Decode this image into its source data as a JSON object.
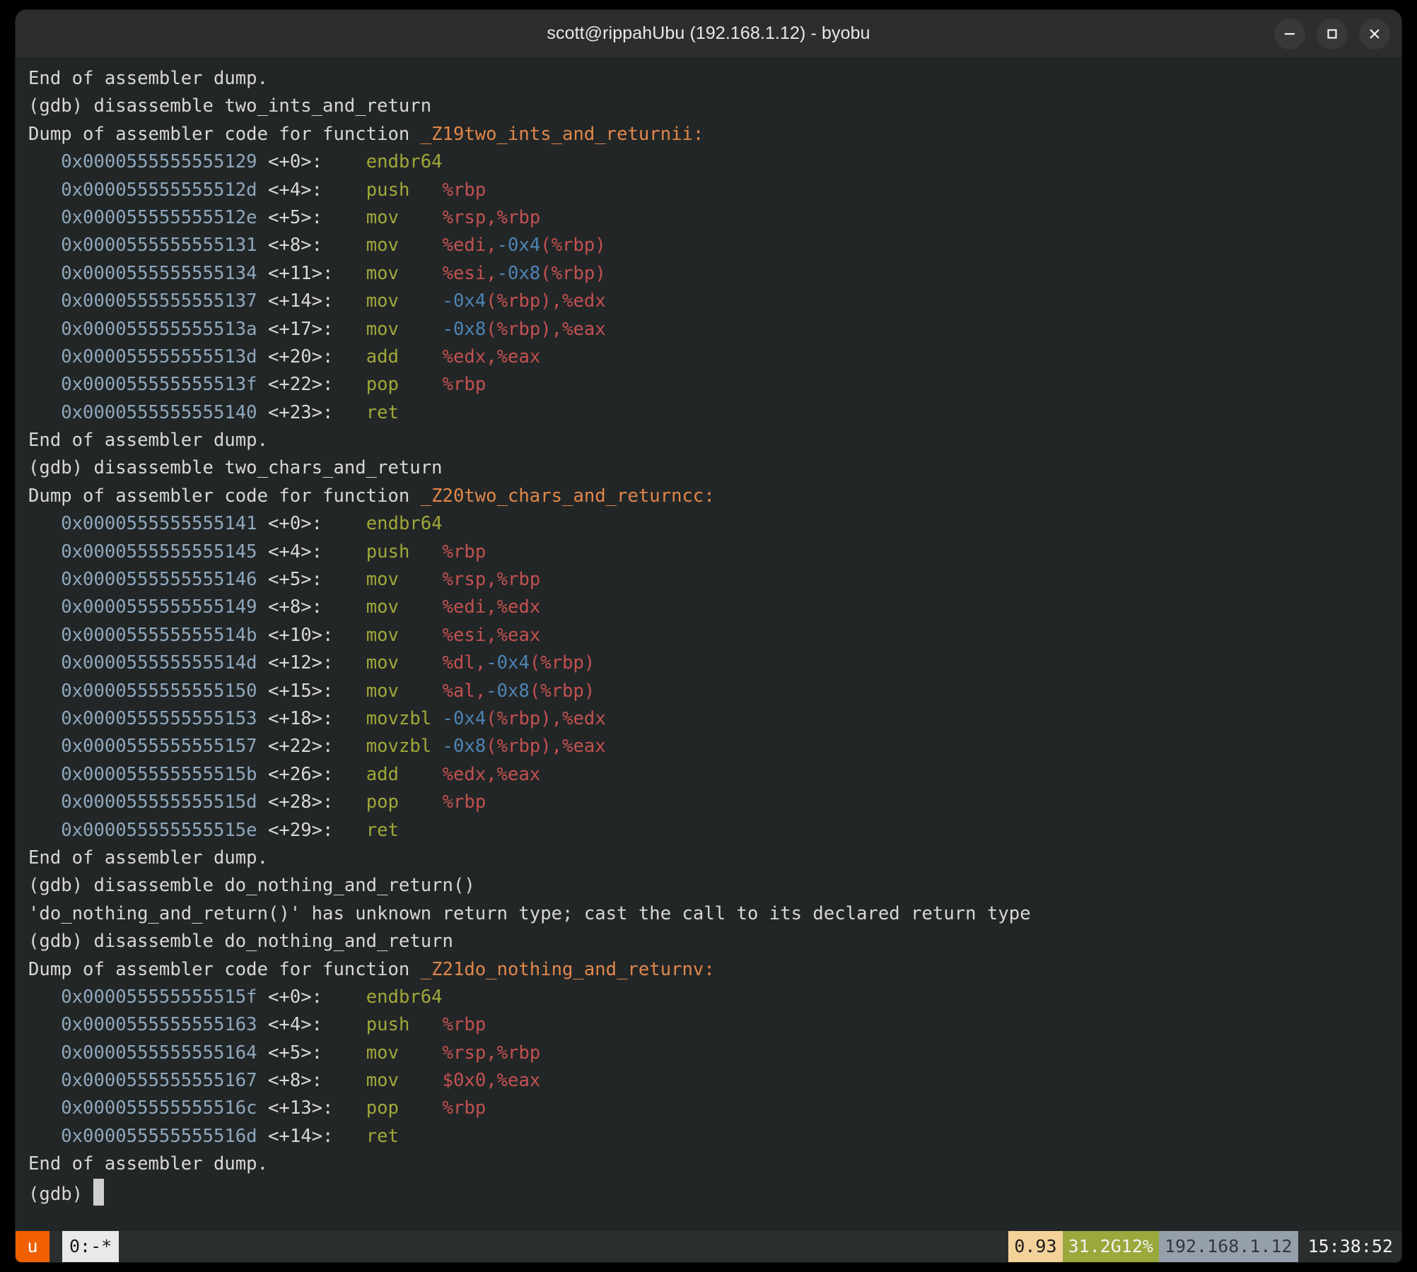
{
  "window": {
    "title": "scott@rippahUbu (192.168.1.12) - byobu",
    "controls": [
      {
        "name": "minimize-button",
        "label": "–"
      },
      {
        "name": "maximize-button",
        "label": "□"
      },
      {
        "name": "close-button",
        "label": "✕"
      }
    ]
  },
  "colors": {
    "background": "#232627",
    "foreground": "#d8d8d4",
    "address": "#8fa8bd",
    "mnemonic": "#a0a838",
    "register": "#c25151",
    "hex_offset": "#4d84b4",
    "symbol": "#e0874a",
    "titlebar": "#2d2d2d",
    "status_u_bg": "#f06000",
    "status_window_bg": "#e9e9e9",
    "status_load_bg": "#f3d29a",
    "status_mem_bg": "#9aa83c",
    "status_ip_bg": "#96a0ad"
  },
  "terminal": {
    "prompt": "(gdb) ",
    "lines": [
      {
        "kind": "plain",
        "text": "End of assembler dump."
      },
      {
        "kind": "prompt",
        "command": "disassemble two_ints_and_return"
      },
      {
        "kind": "header",
        "prefix": "Dump of assembler code for function ",
        "symbol": "_Z19two_ints_and_returnii:"
      },
      {
        "kind": "insn",
        "addr": "0x0000555555555129",
        "off": "<+0>:",
        "mnem": "endbr64",
        "ops": []
      },
      {
        "kind": "insn",
        "addr": "0x000055555555512d",
        "off": "<+4>:",
        "mnem": "push",
        "ops": [
          {
            "t": "reg",
            "v": "%rbp"
          }
        ]
      },
      {
        "kind": "insn",
        "addr": "0x000055555555512e",
        "off": "<+5>:",
        "mnem": "mov",
        "ops": [
          {
            "t": "reg",
            "v": "%rsp,%rbp"
          }
        ]
      },
      {
        "kind": "insn",
        "addr": "0x0000555555555131",
        "off": "<+8>:",
        "mnem": "mov",
        "ops": [
          {
            "t": "reg",
            "v": "%edi,"
          },
          {
            "t": "hex",
            "v": "-0x4"
          },
          {
            "t": "reg",
            "v": "(%rbp)"
          }
        ]
      },
      {
        "kind": "insn",
        "addr": "0x0000555555555134",
        "off": "<+11>:",
        "mnem": "mov",
        "ops": [
          {
            "t": "reg",
            "v": "%esi,"
          },
          {
            "t": "hex",
            "v": "-0x8"
          },
          {
            "t": "reg",
            "v": "(%rbp)"
          }
        ]
      },
      {
        "kind": "insn",
        "addr": "0x0000555555555137",
        "off": "<+14>:",
        "mnem": "mov",
        "ops": [
          {
            "t": "hex",
            "v": "-0x4"
          },
          {
            "t": "reg",
            "v": "(%rbp),%edx"
          }
        ]
      },
      {
        "kind": "insn",
        "addr": "0x000055555555513a",
        "off": "<+17>:",
        "mnem": "mov",
        "ops": [
          {
            "t": "hex",
            "v": "-0x8"
          },
          {
            "t": "reg",
            "v": "(%rbp),%eax"
          }
        ]
      },
      {
        "kind": "insn",
        "addr": "0x000055555555513d",
        "off": "<+20>:",
        "mnem": "add",
        "ops": [
          {
            "t": "reg",
            "v": "%edx,%eax"
          }
        ]
      },
      {
        "kind": "insn",
        "addr": "0x000055555555513f",
        "off": "<+22>:",
        "mnem": "pop",
        "ops": [
          {
            "t": "reg",
            "v": "%rbp"
          }
        ]
      },
      {
        "kind": "insn",
        "addr": "0x0000555555555140",
        "off": "<+23>:",
        "mnem": "ret",
        "ops": []
      },
      {
        "kind": "plain",
        "text": "End of assembler dump."
      },
      {
        "kind": "prompt",
        "command": "disassemble two_chars_and_return"
      },
      {
        "kind": "header",
        "prefix": "Dump of assembler code for function ",
        "symbol": "_Z20two_chars_and_returncc:"
      },
      {
        "kind": "insn",
        "addr": "0x0000555555555141",
        "off": "<+0>:",
        "mnem": "endbr64",
        "ops": []
      },
      {
        "kind": "insn",
        "addr": "0x0000555555555145",
        "off": "<+4>:",
        "mnem": "push",
        "ops": [
          {
            "t": "reg",
            "v": "%rbp"
          }
        ]
      },
      {
        "kind": "insn",
        "addr": "0x0000555555555146",
        "off": "<+5>:",
        "mnem": "mov",
        "ops": [
          {
            "t": "reg",
            "v": "%rsp,%rbp"
          }
        ]
      },
      {
        "kind": "insn",
        "addr": "0x0000555555555149",
        "off": "<+8>:",
        "mnem": "mov",
        "ops": [
          {
            "t": "reg",
            "v": "%edi,%edx"
          }
        ]
      },
      {
        "kind": "insn",
        "addr": "0x000055555555514b",
        "off": "<+10>:",
        "mnem": "mov",
        "ops": [
          {
            "t": "reg",
            "v": "%esi,%eax"
          }
        ]
      },
      {
        "kind": "insn",
        "addr": "0x000055555555514d",
        "off": "<+12>:",
        "mnem": "mov",
        "ops": [
          {
            "t": "reg",
            "v": "%dl,"
          },
          {
            "t": "hex",
            "v": "-0x4"
          },
          {
            "t": "reg",
            "v": "(%rbp)"
          }
        ]
      },
      {
        "kind": "insn",
        "addr": "0x0000555555555150",
        "off": "<+15>:",
        "mnem": "mov",
        "ops": [
          {
            "t": "reg",
            "v": "%al,"
          },
          {
            "t": "hex",
            "v": "-0x8"
          },
          {
            "t": "reg",
            "v": "(%rbp)"
          }
        ]
      },
      {
        "kind": "insn",
        "addr": "0x0000555555555153",
        "off": "<+18>:",
        "mnem": "movzbl",
        "ops": [
          {
            "t": "hex",
            "v": "-0x4"
          },
          {
            "t": "reg",
            "v": "(%rbp),%edx"
          }
        ]
      },
      {
        "kind": "insn",
        "addr": "0x0000555555555157",
        "off": "<+22>:",
        "mnem": "movzbl",
        "ops": [
          {
            "t": "hex",
            "v": "-0x8"
          },
          {
            "t": "reg",
            "v": "(%rbp),%eax"
          }
        ]
      },
      {
        "kind": "insn",
        "addr": "0x000055555555515b",
        "off": "<+26>:",
        "mnem": "add",
        "ops": [
          {
            "t": "reg",
            "v": "%edx,%eax"
          }
        ]
      },
      {
        "kind": "insn",
        "addr": "0x000055555555515d",
        "off": "<+28>:",
        "mnem": "pop",
        "ops": [
          {
            "t": "reg",
            "v": "%rbp"
          }
        ]
      },
      {
        "kind": "insn",
        "addr": "0x000055555555515e",
        "off": "<+29>:",
        "mnem": "ret",
        "ops": []
      },
      {
        "kind": "plain",
        "text": "End of assembler dump."
      },
      {
        "kind": "prompt",
        "command": "disassemble do_nothing_and_return()"
      },
      {
        "kind": "plain",
        "text": "'do_nothing_and_return()' has unknown return type; cast the call to its declared return type"
      },
      {
        "kind": "prompt",
        "command": "disassemble do_nothing_and_return"
      },
      {
        "kind": "header",
        "prefix": "Dump of assembler code for function ",
        "symbol": "_Z21do_nothing_and_returnv:"
      },
      {
        "kind": "insn",
        "addr": "0x000055555555515f",
        "off": "<+0>:",
        "mnem": "endbr64",
        "ops": []
      },
      {
        "kind": "insn",
        "addr": "0x0000555555555163",
        "off": "<+4>:",
        "mnem": "push",
        "ops": [
          {
            "t": "reg",
            "v": "%rbp"
          }
        ]
      },
      {
        "kind": "insn",
        "addr": "0x0000555555555164",
        "off": "<+5>:",
        "mnem": "mov",
        "ops": [
          {
            "t": "reg",
            "v": "%rsp,%rbp"
          }
        ]
      },
      {
        "kind": "insn",
        "addr": "0x0000555555555167",
        "off": "<+8>:",
        "mnem": "mov",
        "ops": [
          {
            "t": "reg",
            "v": "$0x0,%eax"
          }
        ]
      },
      {
        "kind": "insn",
        "addr": "0x000055555555516c",
        "off": "<+13>:",
        "mnem": "pop",
        "ops": [
          {
            "t": "reg",
            "v": "%rbp"
          }
        ]
      },
      {
        "kind": "insn",
        "addr": "0x000055555555516d",
        "off": "<+14>:",
        "mnem": "ret",
        "ops": []
      },
      {
        "kind": "plain",
        "text": "End of assembler dump."
      },
      {
        "kind": "prompt-cursor",
        "command": ""
      }
    ]
  },
  "statusbar": {
    "session_indicator": "u",
    "window_list": "0:-*",
    "load_average": "0.93",
    "memory": "31.2G12%",
    "ip_address": "192.168.1.12",
    "clock": "15:38:52"
  }
}
